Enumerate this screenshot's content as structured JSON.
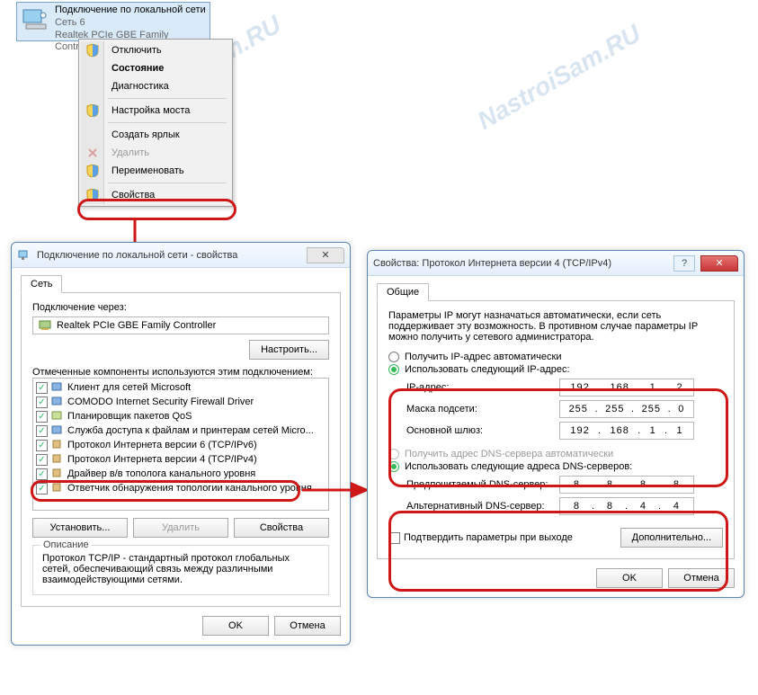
{
  "watermark": "NastroiSam.RU",
  "adapter": {
    "title": "Подключение по локальной сети",
    "network": "Сеть 6",
    "device": "Realtek PCIe GBE Family Controll..."
  },
  "context_menu": {
    "disable": "Отключить",
    "status": "Состояние",
    "diagnostics": "Диагностика",
    "bridge": "Настройка моста",
    "shortcut": "Создать ярлык",
    "delete": "Удалить",
    "rename": "Переименовать",
    "properties": "Свойства"
  },
  "props_window": {
    "title": "Подключение по локальной сети - свойства",
    "tab_net": "Сеть",
    "connect_using": "Подключение через:",
    "adapter_name": "Realtek PCIe GBE Family Controller",
    "configure": "Настроить...",
    "components_label": "Отмеченные компоненты используются этим подключением:",
    "components": [
      "Клиент для сетей Microsoft",
      "COMODO Internet Security Firewall Driver",
      "Планировщик пакетов QoS",
      "Служба доступа к файлам и принтерам сетей Micro...",
      "Протокол Интернета версии 6 (TCP/IPv6)",
      "Протокол Интернета версии 4 (TCP/IPv4)",
      "Драйвер в/в тополога канального уровня",
      "Ответчик обнаружения топологии канального уровня"
    ],
    "install": "Установить...",
    "remove": "Удалить",
    "props_btn": "Свойства",
    "desc_title": "Описание",
    "desc_text": "Протокол TCP/IP - стандартный протокол глобальных сетей, обеспечивающий связь между различными взаимодействующими сетями.",
    "ok": "OK",
    "cancel": "Отмена"
  },
  "ipv4_window": {
    "title": "Свойства: Протокол Интернета версии 4 (TCP/IPv4)",
    "tab_general": "Общие",
    "intro": "Параметры IP могут назначаться автоматически, если сеть поддерживает эту возможность. В противном случае параметры IP можно получить у сетевого администратора.",
    "ip_auto": "Получить IP-адрес автоматически",
    "ip_manual": "Использовать следующий IP-адрес:",
    "ip_label": "IP-адрес:",
    "mask_label": "Маска подсети:",
    "gw_label": "Основной шлюз:",
    "ip_value": [
      "192",
      "168",
      "1",
      "2"
    ],
    "mask_value": [
      "255",
      "255",
      "255",
      "0"
    ],
    "gw_value": [
      "192",
      "168",
      "1",
      "1"
    ],
    "dns_auto": "Получить адрес DNS-сервера автоматически",
    "dns_manual": "Использовать следующие адреса DNS-серверов:",
    "dns1_label": "Предпочитаемый DNS-сервер:",
    "dns2_label": "Альтернативный DNS-сервер:",
    "dns1_value": [
      "8",
      "8",
      "8",
      "8"
    ],
    "dns2_value": [
      "8",
      "8",
      "4",
      "4"
    ],
    "confirm_exit": "Подтвердить параметры при выходе",
    "advanced": "Дополнительно...",
    "ok": "OK",
    "cancel": "Отмена"
  }
}
